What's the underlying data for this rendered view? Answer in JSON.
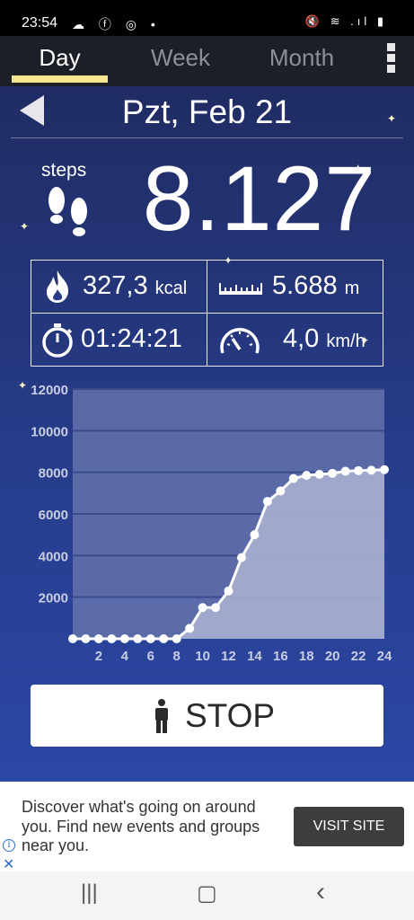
{
  "status_bar": {
    "time": "23:54",
    "left_icons": "☁ ⓕ ◎ •",
    "right_icons": "🔇 ≋ .ıl ▮"
  },
  "tabs": [
    {
      "label": "Day",
      "active": true
    },
    {
      "label": "Week",
      "active": false
    },
    {
      "label": "Month",
      "active": false
    }
  ],
  "header": {
    "date": "Pzt, Feb 21"
  },
  "steps": {
    "label": "steps",
    "value": "8.127"
  },
  "stats": {
    "calories": {
      "value": "327,3",
      "unit": "kcal"
    },
    "distance": {
      "value": "5.688",
      "unit": "m"
    },
    "duration": {
      "value": "01:24:21"
    },
    "speed": {
      "value": "4,0",
      "unit": "km/h"
    }
  },
  "chart_data": {
    "type": "area",
    "title": "",
    "xlabel": "",
    "ylabel": "",
    "x": [
      0,
      1,
      2,
      3,
      4,
      5,
      6,
      7,
      8,
      9,
      10,
      11,
      12,
      13,
      14,
      15,
      16,
      17,
      18,
      19,
      20,
      21,
      22,
      23,
      24
    ],
    "values": [
      0,
      0,
      0,
      0,
      0,
      0,
      0,
      0,
      0,
      500,
      1500,
      1500,
      2300,
      3900,
      5000,
      6600,
      7100,
      7700,
      7850,
      7900,
      7950,
      8050,
      8080,
      8100,
      8127
    ],
    "xticks": [
      "2",
      "4",
      "6",
      "8",
      "10",
      "12",
      "14",
      "16",
      "18",
      "20",
      "22",
      "24"
    ],
    "yticks": [
      "2000",
      "4000",
      "6000",
      "8000",
      "10000",
      "12000"
    ],
    "xlim": [
      0,
      24
    ],
    "ylim": [
      0,
      12000
    ],
    "grid": true,
    "colors": {
      "line": "#ffffff",
      "fill": "#a7afd0",
      "plot_bg": "#6472aa"
    }
  },
  "stop_button": {
    "label": "STOP"
  },
  "ad": {
    "text": "Discover what's going on around you. Find new events and groups near you.",
    "button": "VISIT SITE",
    "info_glyph": "i",
    "close_glyph": "✕"
  },
  "nav_bar": {
    "recents": "|||",
    "home": "▢",
    "back": "‹"
  }
}
